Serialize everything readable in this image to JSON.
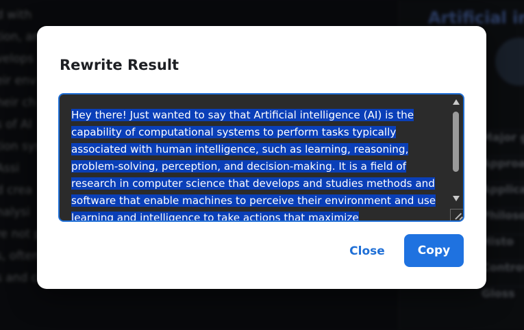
{
  "background": {
    "article_lines": [
      {
        "text": "d with ",
        "links": []
      },
      {
        "text": "tion, and",
        "links": []
      },
      {
        "text": "velops",
        "links": []
      },
      {
        "text": "eir env",
        "links": []
      },
      {
        "text": "heir ch",
        "links": []
      },
      {
        "text": "",
        "links": []
      },
      {
        "text": "s of AI",
        "links": []
      },
      {
        "text": "tion syst",
        "links": []
      },
      {
        "text": "Assi",
        "links": []
      },
      {
        "text": "d crea",
        "links": []
      },
      {
        "text": "nalysi",
        "links": []
      },
      {
        "text": "re not p",
        "links": []
      },
      {
        "text": "s, often without being called AI because once something",
        "links": []
      },
      {
        "text": "s and common enough it's not labeled AI anymore.",
        "links": []
      }
    ],
    "side_title": "Artificial in",
    "side_rows": [
      "Major g",
      "Approa",
      "Applica",
      "Philoso",
      "Histo",
      "Controv",
      "Gloss"
    ]
  },
  "dialog": {
    "title": "Rewrite Result",
    "result_text": "Hey there! Just wanted to say that Artificial intelligence (AI) is the capability of computational systems to perform tasks typically associated with human intelligence, such as learning, reasoning, problem-solving, perception, and decision-making. It is a field of research in computer science that develops and studies methods and software that enable machines to perceive their environment and use learning and intelligence to take actions that maximize",
    "close_label": "Close",
    "copy_label": "Copy"
  },
  "colors": {
    "accent": "#1f72e0",
    "selection": "#0a3fb8",
    "textarea_bg": "#2b2b2b"
  }
}
